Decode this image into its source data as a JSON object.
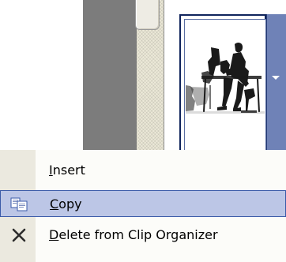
{
  "clip_gallery": {
    "clip_icon": "person-at-computer-clipart",
    "dropdown_icon": "chevron-down-icon"
  },
  "context_menu": {
    "items": [
      {
        "label": "Insert",
        "accelerator": "I",
        "icon": ""
      },
      {
        "label": "Copy",
        "accelerator": "C",
        "icon": "copy-icon",
        "highlighted": true
      },
      {
        "label": "Delete from Clip Organizer",
        "accelerator": "D",
        "icon": "delete-x-icon"
      }
    ]
  },
  "colors": {
    "highlight": "#bcc6e6",
    "highlight_border": "#3a5aa8",
    "selection_frame": "#10245c",
    "dropdown_button": "#6f82b7"
  }
}
